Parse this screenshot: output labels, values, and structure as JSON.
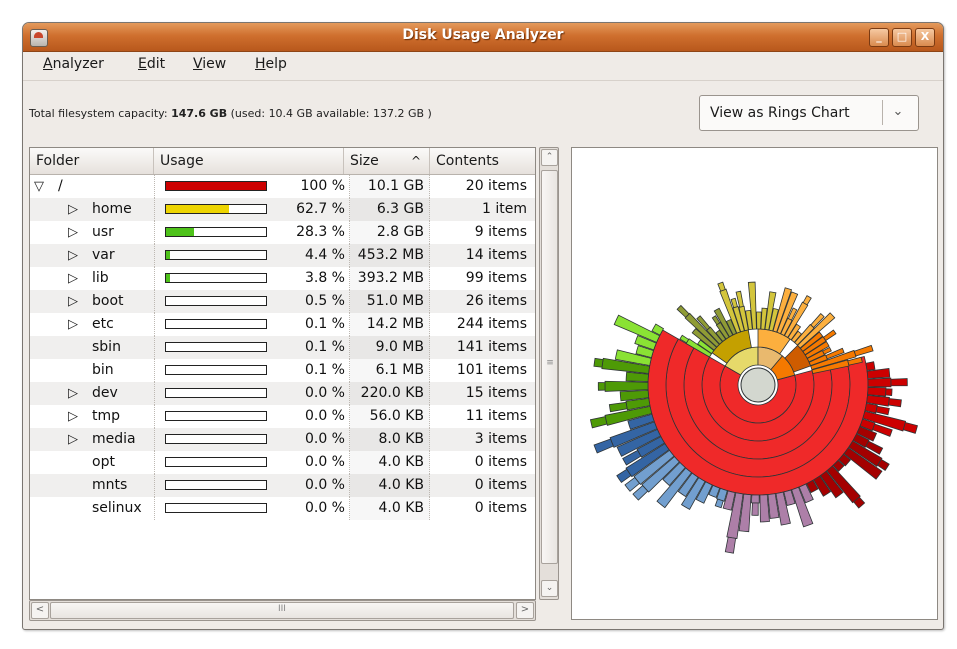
{
  "window": {
    "title": "Disk Usage Analyzer",
    "buttons": [
      "_",
      "□",
      "X"
    ]
  },
  "menu": [
    {
      "label": "Analyzer",
      "mnemonic": "A",
      "rest": "nalyzer"
    },
    {
      "label": "Edit",
      "mnemonic": "E",
      "rest": "dit"
    },
    {
      "label": "View",
      "mnemonic": "V",
      "rest": "iew"
    },
    {
      "label": "Help",
      "mnemonic": "H",
      "rest": "elp"
    }
  ],
  "capacity": {
    "prefix": "Total filesystem capacity:",
    "total": "147.6 GB",
    "used_label": "(used:",
    "used": "10.4 GB",
    "available_label": "available:",
    "available": "137.2 GB",
    "suffix": ")"
  },
  "view_combo": {
    "selected": "View as Rings Chart"
  },
  "table": {
    "headers": {
      "folder": "Folder",
      "usage": "Usage",
      "size": "Size",
      "contents": "Contents"
    },
    "sort_indicator": "^",
    "rows": [
      {
        "name": "/",
        "expander": "open",
        "indent": 0,
        "percent": 100,
        "usage": "100 %",
        "size": "10.1 GB",
        "contents": "20 items",
        "color": "#cc0000"
      },
      {
        "name": "home",
        "expander": "closed",
        "indent": 1,
        "percent": 62.7,
        "usage": "62.7 %",
        "size": "6.3 GB",
        "contents": "1 item",
        "color": "#edd400"
      },
      {
        "name": "usr",
        "expander": "closed",
        "indent": 1,
        "percent": 28.3,
        "usage": "28.3 %",
        "size": "2.8 GB",
        "contents": "9 items",
        "color": "#4ec21a"
      },
      {
        "name": "var",
        "expander": "closed",
        "indent": 1,
        "percent": 4.4,
        "usage": "4.4 %",
        "size": "453.2 MB",
        "contents": "14 items",
        "color": "#4ec21a"
      },
      {
        "name": "lib",
        "expander": "closed",
        "indent": 1,
        "percent": 3.8,
        "usage": "3.8 %",
        "size": "393.2 MB",
        "contents": "99 items",
        "color": "#4ec21a"
      },
      {
        "name": "boot",
        "expander": "closed",
        "indent": 1,
        "percent": 0.5,
        "usage": "0.5 %",
        "size": "51.0 MB",
        "contents": "26 items",
        "color": "#4ec21a"
      },
      {
        "name": "etc",
        "expander": "closed",
        "indent": 1,
        "percent": 0.1,
        "usage": "0.1 %",
        "size": "14.2 MB",
        "contents": "244 items",
        "color": "#4ec21a"
      },
      {
        "name": "sbin",
        "expander": "none",
        "indent": 1,
        "percent": 0.1,
        "usage": "0.1 %",
        "size": "9.0 MB",
        "contents": "141 items",
        "color": "#4ec21a"
      },
      {
        "name": "bin",
        "expander": "none",
        "indent": 1,
        "percent": 0.1,
        "usage": "0.1 %",
        "size": "6.1 MB",
        "contents": "101 items",
        "color": "#4ec21a"
      },
      {
        "name": "dev",
        "expander": "closed",
        "indent": 1,
        "percent": 0.0,
        "usage": "0.0 %",
        "size": "220.0 KB",
        "contents": "15 items",
        "color": "#4ec21a"
      },
      {
        "name": "tmp",
        "expander": "closed",
        "indent": 1,
        "percent": 0.0,
        "usage": "0.0 %",
        "size": "56.0 KB",
        "contents": "11 items",
        "color": "#4ec21a"
      },
      {
        "name": "media",
        "expander": "closed",
        "indent": 1,
        "percent": 0.0,
        "usage": "0.0 %",
        "size": "8.0 KB",
        "contents": "3 items",
        "color": "#4ec21a"
      },
      {
        "name": "opt",
        "expander": "none",
        "indent": 1,
        "percent": 0.0,
        "usage": "0.0 %",
        "size": "4.0 KB",
        "contents": "0 items",
        "color": "#4ec21a"
      },
      {
        "name": "mnts",
        "expander": "none",
        "indent": 1,
        "percent": 0.0,
        "usage": "0.0 %",
        "size": "4.0 KB",
        "contents": "0 items",
        "color": "#4ec21a"
      },
      {
        "name": "selinux",
        "expander": "none",
        "indent": 1,
        "percent": 0.0,
        "usage": "0.0 %",
        "size": "4.0 KB",
        "contents": "0 items",
        "color": "#4ec21a"
      }
    ]
  },
  "scrollbars": {
    "horizontal_grip": "III",
    "vertical_grip": "≡"
  },
  "rings_chart": {
    "center_color": "#d3d7cf",
    "main_ring_color": "#ef2929",
    "sector_colors": [
      "#e9b96e",
      "#c4a000",
      "#fcaf3e",
      "#f57900",
      "#cc0000",
      "#a40000",
      "#ad7fa8",
      "#75507b",
      "#729fcf",
      "#3465a4",
      "#8ae234",
      "#4e9a06",
      "#8f9b35",
      "#d3c53c"
    ]
  }
}
